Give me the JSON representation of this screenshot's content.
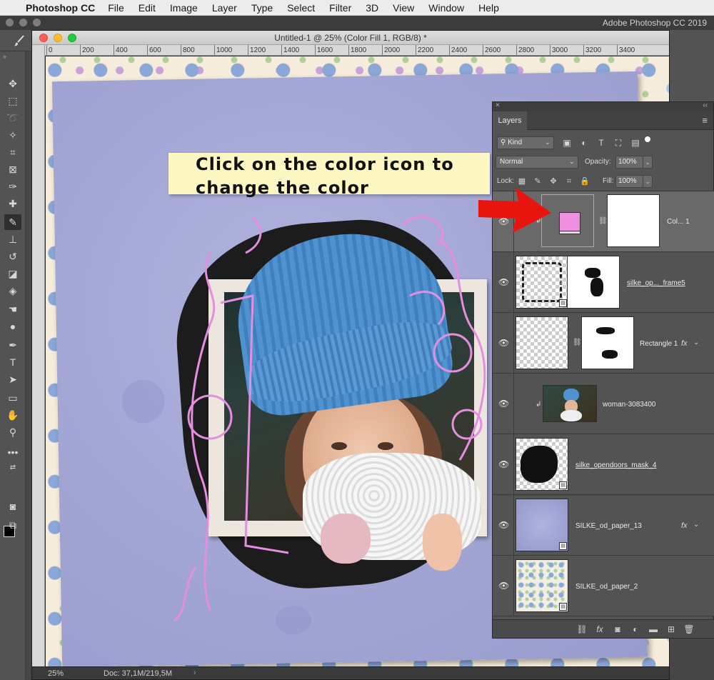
{
  "menubar": {
    "apple": "",
    "app_name": "Photoshop CC",
    "items": [
      "File",
      "Edit",
      "Image",
      "Layer",
      "Type",
      "Select",
      "Filter",
      "3D",
      "View",
      "Window",
      "Help"
    ]
  },
  "app_title": "Adobe Photoshop CC 2019",
  "document": {
    "title": "Untitled-1 @ 25% (Color Fill 1, RGB/8) *",
    "ruler_ticks": [
      "0",
      "200",
      "400",
      "600",
      "800",
      "1000",
      "1200",
      "1400",
      "1600",
      "1800",
      "2000",
      "2200",
      "2400",
      "2600",
      "2800",
      "3000",
      "3200",
      "3400"
    ],
    "status_zoom": "25%",
    "status_doc": "Doc: 37,1M/219,5M",
    "status_more": "›"
  },
  "callout": {
    "line1": "Click on the color icon to",
    "line2": "change the color"
  },
  "colors": {
    "accent_arrow": "#e8150f",
    "color_fill_swatch": "#ef8fe0",
    "paper": "#a3a6d4",
    "callout_bg": "#fdf7c3"
  },
  "layers_panel": {
    "close": "×",
    "collapse": "‹‹",
    "tab": "Layers",
    "menu": "≡",
    "kind_label": "Kind",
    "blend_mode": "Normal",
    "opacity_label": "Opacity:",
    "opacity_value": "100%",
    "lock_label": "Lock:",
    "fill_label": "Fill:",
    "fill_value": "100%",
    "layers": [
      {
        "name": "Col... 1",
        "fx": "",
        "clipped": true,
        "selected": true
      },
      {
        "name": "silke_op..._frame5",
        "fx": "",
        "clipped": false,
        "selected": false
      },
      {
        "name": "Rectangle 1",
        "fx": "fx",
        "clipped": false,
        "selected": false
      },
      {
        "name": "woman-3083400",
        "fx": "",
        "clipped": true,
        "selected": false
      },
      {
        "name": "silke_opendoors_mask_4",
        "fx": "",
        "clipped": false,
        "selected": false
      },
      {
        "name": "SILKE_od_paper_13",
        "fx": "fx",
        "clipped": false,
        "selected": false
      },
      {
        "name": "SILKE_od_paper_2",
        "fx": "",
        "clipped": false,
        "selected": false
      }
    ],
    "footer_icons": [
      "link-icon",
      "fx-icon",
      "mask-icon",
      "adjustment-icon",
      "folder-icon",
      "new-layer-icon",
      "trash-icon"
    ]
  },
  "toolbar_icons": [
    "move-icon",
    "marquee-icon",
    "lasso-icon",
    "magic-wand-icon",
    "crop-icon",
    "frame-icon",
    "eyedropper-icon",
    "healing-icon",
    "brush-icon",
    "stamp-icon",
    "history-brush-icon",
    "eraser-icon",
    "paint-bucket-icon",
    "smudge-icon",
    "dodge-icon",
    "pen-icon",
    "type-icon",
    "path-select-icon",
    "rectangle-icon",
    "hand-icon",
    "zoom-icon",
    "more-tools-icon"
  ]
}
